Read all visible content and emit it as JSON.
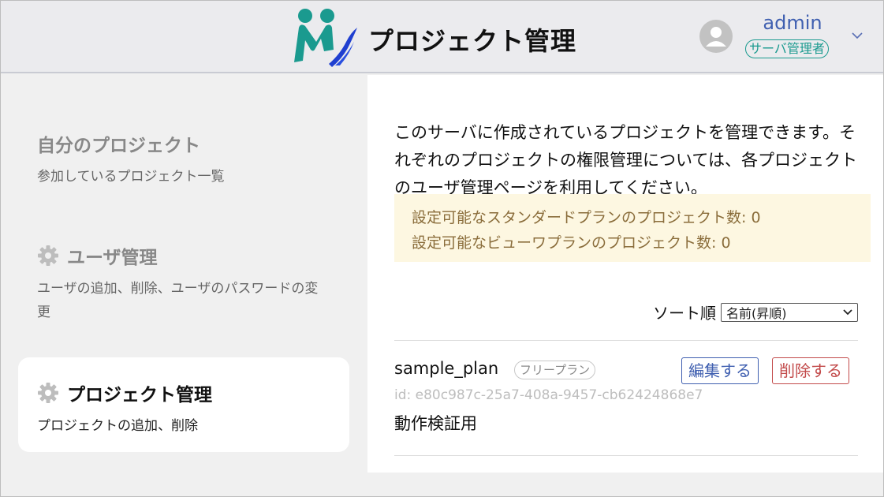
{
  "header": {
    "app_title": "プロジェクト管理",
    "user": {
      "name": "admin",
      "role": "サーバ管理者"
    },
    "icons": [
      "app-logo-icon",
      "user-avatar-icon",
      "chevron-down-icon"
    ]
  },
  "sidebar": {
    "items": [
      {
        "title": "自分のプロジェクト",
        "desc": "参加しているプロジェクト一覧",
        "icon": ""
      },
      {
        "title": "ユーザ管理",
        "desc": "ユーザの追加、削除、ユーザのパスワードの変更",
        "icon": "gear-icon"
      },
      {
        "title": "プロジェクト管理",
        "desc": "プロジェクトの追加、削除",
        "icon": "gear-icon"
      }
    ]
  },
  "main": {
    "intro": "このサーバに作成されているプロジェクトを管理できます。それぞれのプロジェクトの権限管理については、各プロジェクトのユーザ管理ページを利用してください。",
    "notice": {
      "standard": "設定可能なスタンダードプランのプロジェクト数: 0",
      "viewer": "設定可能なビューワプランのプロジェクト数: 0"
    },
    "sort": {
      "label": "ソート順",
      "selected": "名前(昇順)"
    },
    "projects": [
      {
        "name": "sample_plan",
        "plan": "フリープラン",
        "id": "id: e80c987c-25a7-408a-9457-cb62424868e7",
        "description": "動作検証用",
        "edit_label": "編集する",
        "delete_label": "削除する"
      }
    ]
  },
  "colors": {
    "accent_blue": "#3f5fb0",
    "teal": "#1a9a8f",
    "danger": "#c24a4a",
    "notice_bg": "#fdf7e1",
    "notice_text": "#8a6d3b"
  }
}
